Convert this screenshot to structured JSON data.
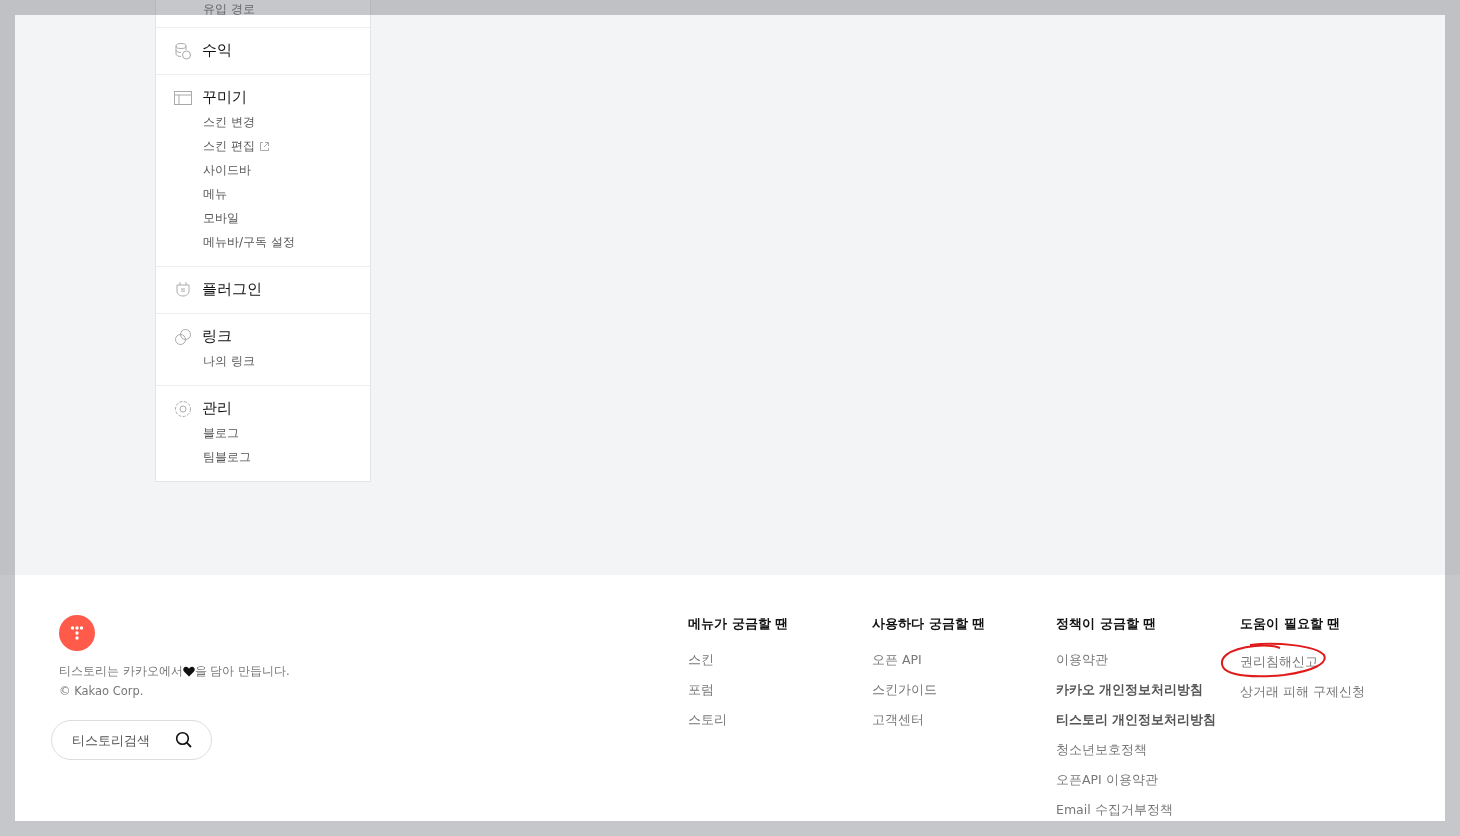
{
  "sidebar": {
    "sections": [
      {
        "kind": "partial",
        "items": [
          {
            "label": "유입 경로",
            "external": false
          }
        ]
      },
      {
        "kind": "revenue",
        "title": "수익"
      },
      {
        "kind": "design",
        "title": "꾸미기",
        "items": [
          {
            "label": "스킨 변경",
            "external": false
          },
          {
            "label": "스킨 편집",
            "external": true
          },
          {
            "label": "사이드바",
            "external": false
          },
          {
            "label": "메뉴",
            "external": false
          },
          {
            "label": "모바일",
            "external": false
          },
          {
            "label": "메뉴바/구독 설정",
            "external": false
          }
        ]
      },
      {
        "kind": "plugin",
        "title": "플러그인"
      },
      {
        "kind": "link",
        "title": "링크",
        "items": [
          {
            "label": "나의 링크",
            "external": false
          }
        ]
      },
      {
        "kind": "admin",
        "title": "관리",
        "items": [
          {
            "label": "블로그",
            "external": false
          },
          {
            "label": "팀블로그",
            "external": false
          }
        ]
      }
    ]
  },
  "footer": {
    "tagline_before": "티스토리는 카카오에서 ",
    "tagline_after": "을 담아 만듭니다.",
    "copyright": "© Kakao Corp.",
    "search": {
      "placeholder": "티스토리검색"
    },
    "columns": [
      {
        "heading": "메뉴가 궁금할 땐",
        "links": [
          {
            "label": "스킨",
            "emphasized": false,
            "circled": false
          },
          {
            "label": "포럼",
            "emphasized": false,
            "circled": false
          },
          {
            "label": "스토리",
            "emphasized": false,
            "circled": false
          }
        ]
      },
      {
        "heading": "사용하다 궁금할 땐",
        "links": [
          {
            "label": "오픈 API",
            "emphasized": false,
            "circled": false
          },
          {
            "label": "스킨가이드",
            "emphasized": false,
            "circled": false
          },
          {
            "label": "고객센터",
            "emphasized": false,
            "circled": false
          }
        ]
      },
      {
        "heading": "정책이 궁금할 땐",
        "links": [
          {
            "label": "이용약관",
            "emphasized": false,
            "circled": false
          },
          {
            "label": "카카오 개인정보처리방침",
            "emphasized": true,
            "circled": false
          },
          {
            "label": "티스토리 개인정보처리방침",
            "emphasized": true,
            "circled": false
          },
          {
            "label": "청소년보호정책",
            "emphasized": false,
            "circled": false
          },
          {
            "label": "오픈API 이용약관",
            "emphasized": false,
            "circled": false
          },
          {
            "label": "Email 수집거부정책",
            "emphasized": false,
            "circled": false
          }
        ]
      },
      {
        "heading": "도움이 필요할 땐",
        "links": [
          {
            "label": "권리침해신고",
            "emphasized": false,
            "circled": true
          },
          {
            "label": "상거래 피해 구제신청",
            "emphasized": false,
            "circled": false
          }
        ]
      }
    ]
  }
}
